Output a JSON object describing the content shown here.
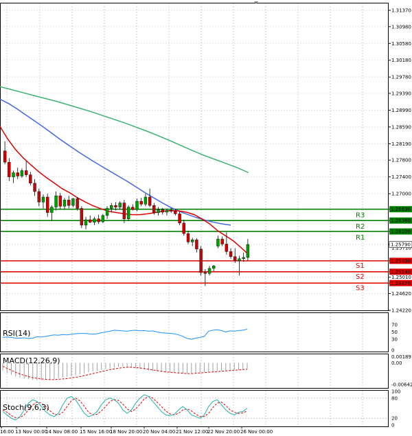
{
  "chart_data": {
    "type": "candlestick",
    "instrument": "",
    "main": {
      "ylim": [
        1.2422,
        1.3155
      ],
      "y_ticks": [
        "1.31370",
        "1.30980",
        "1.30580",
        "1.30180",
        "1.29780",
        "1.29390",
        "1.28990",
        "1.28590",
        "1.28190",
        "1.27800",
        "1.27400",
        "1.27000",
        "1.26630",
        "1.26360",
        "1.26100",
        "1.25790",
        "1.25400",
        "1.25140",
        "1.25010",
        "1.24870",
        "1.24620",
        "1.24220"
      ],
      "grid": true,
      "levels": [
        {
          "label": "R3",
          "value": 1.2663,
          "price": "1.26630",
          "color": "#008000"
        },
        {
          "label": "R2",
          "value": 1.2636,
          "price": "1.26360",
          "color": "#008000"
        },
        {
          "label": "R1",
          "value": 1.261,
          "price": "1.26100",
          "color": "#008000"
        },
        {
          "label": "S1",
          "value": 1.254,
          "price": "1.25400",
          "color": "#e00000"
        },
        {
          "label": "S2",
          "value": 1.2514,
          "price": "1.25140",
          "color": "#e00000"
        },
        {
          "label": "S3",
          "value": 1.2487,
          "price": "1.24870",
          "color": "#e00000"
        }
      ],
      "extra_tick": {
        "price": "1.25710",
        "value": 1.2571
      },
      "current": {
        "price": "1.25790",
        "value": 1.2579
      },
      "candles": [
        [
          1.2802,
          1.2825,
          1.277,
          1.2775
        ],
        [
          1.2775,
          1.2785,
          1.273,
          1.274
        ],
        [
          1.274,
          1.2755,
          1.2725,
          1.275
        ],
        [
          1.275,
          1.2762,
          1.2735,
          1.2742
        ],
        [
          1.2742,
          1.276,
          1.2738,
          1.2755
        ],
        [
          1.2755,
          1.2778,
          1.274,
          1.2745
        ],
        [
          1.2745,
          1.2752,
          1.272,
          1.2725
        ],
        [
          1.2725,
          1.2735,
          1.2695,
          1.2705
        ],
        [
          1.2705,
          1.2712,
          1.267,
          1.268
        ],
        [
          1.268,
          1.2698,
          1.2665,
          1.2692
        ],
        [
          1.2692,
          1.27,
          1.2645,
          1.2655
        ],
        [
          1.2655,
          1.2672,
          1.2635,
          1.2668
        ],
        [
          1.2668,
          1.2705,
          1.266,
          1.2695
        ],
        [
          1.2695,
          1.2702,
          1.2662,
          1.267
        ],
        [
          1.267,
          1.269,
          1.2662,
          1.2685
        ],
        [
          1.2685,
          1.2695,
          1.2665,
          1.2672
        ],
        [
          1.2672,
          1.269,
          1.2668,
          1.2688
        ],
        [
          1.2688,
          1.2692,
          1.266,
          1.2665
        ],
        [
          1.2665,
          1.267,
          1.2618,
          1.2625
        ],
        [
          1.2625,
          1.2645,
          1.2615,
          1.2638
        ],
        [
          1.2638,
          1.2648,
          1.263,
          1.2632
        ],
        [
          1.2632,
          1.2645,
          1.2625,
          1.264
        ],
        [
          1.264,
          1.265,
          1.2628,
          1.2633
        ],
        [
          1.2633,
          1.2652,
          1.263,
          1.2648
        ],
        [
          1.2648,
          1.267,
          1.264,
          1.2665
        ],
        [
          1.2665,
          1.2678,
          1.2655,
          1.2672
        ],
        [
          1.2672,
          1.268,
          1.266,
          1.2668
        ],
        [
          1.2668,
          1.2682,
          1.2662,
          1.2678
        ],
        [
          1.2678,
          1.2685,
          1.263,
          1.264
        ],
        [
          1.264,
          1.2672,
          1.2635,
          1.2668
        ],
        [
          1.2668,
          1.2675,
          1.266,
          1.2662
        ],
        [
          1.2662,
          1.2688,
          1.2658,
          1.2682
        ],
        [
          1.2682,
          1.269,
          1.267,
          1.2675
        ],
        [
          1.2675,
          1.27,
          1.267,
          1.2692
        ],
        [
          1.2692,
          1.2712,
          1.2668,
          1.2672
        ],
        [
          1.2672,
          1.2678,
          1.265,
          1.2655
        ],
        [
          1.2655,
          1.2668,
          1.2648,
          1.2662
        ],
        [
          1.2662,
          1.2666,
          1.265,
          1.2656
        ],
        [
          1.2656,
          1.2664,
          1.2648,
          1.266
        ],
        [
          1.266,
          1.2666,
          1.2654,
          1.2658
        ],
        [
          1.2658,
          1.2664,
          1.2648,
          1.2652
        ],
        [
          1.2652,
          1.2658,
          1.2625,
          1.263
        ],
        [
          1.263,
          1.2638,
          1.26,
          1.2605
        ],
        [
          1.2605,
          1.2612,
          1.258,
          1.2585
        ],
        [
          1.2585,
          1.2595,
          1.2575,
          1.259
        ],
        [
          1.259,
          1.2594,
          1.256,
          1.2568
        ],
        [
          1.2568,
          1.2575,
          1.2505,
          1.2512
        ],
        [
          1.2512,
          1.252,
          1.248,
          1.251
        ],
        [
          1.251,
          1.2528,
          1.2505,
          1.2522
        ],
        [
          1.2522,
          1.253,
          1.2515,
          1.2528
        ],
        [
          1.2575,
          1.26,
          1.257,
          1.2592
        ],
        [
          1.2592,
          1.2598,
          1.2575,
          1.258
        ],
        [
          1.258,
          1.2608,
          1.2555,
          1.2562
        ],
        [
          1.2562,
          1.257,
          1.2545,
          1.255
        ],
        [
          1.255,
          1.257,
          1.2535,
          1.254
        ],
        [
          1.254,
          1.2552,
          1.2505,
          1.2545
        ],
        [
          1.2545,
          1.256,
          1.2538,
          1.2548
        ],
        [
          1.2548,
          1.2592,
          1.254,
          1.2579
        ]
      ],
      "ma_fast": [
        1.286,
        1.283,
        1.2805,
        1.2785,
        1.2768,
        1.2752,
        1.2738,
        1.2725,
        1.2712,
        1.2702,
        1.269,
        1.268,
        1.2671,
        1.2664,
        1.2658,
        1.2655,
        1.2652,
        1.265,
        1.265,
        1.2652,
        1.2655,
        1.2658,
        1.266,
        1.2659,
        1.2656,
        1.265,
        1.264,
        1.2628,
        1.2612,
        1.26,
        1.2588,
        1.2572,
        1.2555
      ],
      "ma_mid": [
        1.2925,
        1.2915,
        1.2902,
        1.2888,
        1.2874,
        1.286,
        1.2845,
        1.283,
        1.2816,
        1.2802,
        1.2789,
        1.2776,
        1.2764,
        1.2752,
        1.274,
        1.2728,
        1.2715,
        1.2702,
        1.269,
        1.2678,
        1.2667,
        1.2658,
        1.265,
        1.2643,
        1.2637,
        1.2632,
        1.2628,
        1.2625
      ],
      "ma_slow": [
        1.2955,
        1.2948,
        1.2941,
        1.2934,
        1.2927,
        1.292,
        1.2912,
        1.2904,
        1.2896,
        1.2887,
        1.2878,
        1.2869,
        1.2859,
        1.2849,
        1.2838,
        1.2827,
        1.2815,
        1.2803,
        1.2792,
        1.2782,
        1.2772,
        1.2762,
        1.275
      ]
    },
    "rsi": {
      "title": "RSI(14)",
      "ylim": [
        0,
        100
      ],
      "ticks": [
        "70",
        "50",
        "30",
        "0"
      ],
      "values": [
        35,
        36,
        35,
        33,
        33,
        34,
        32,
        33,
        37,
        36,
        38,
        40,
        42,
        41,
        43,
        42,
        44,
        45,
        46,
        46,
        45,
        44,
        45,
        48,
        50,
        52,
        55,
        54,
        53,
        52,
        54,
        55,
        53,
        54,
        52,
        53,
        50,
        48,
        47,
        46,
        45,
        42,
        38,
        32,
        30,
        33,
        35,
        38,
        52,
        55,
        56,
        54,
        50,
        53,
        52,
        54,
        55,
        58
      ]
    },
    "macd": {
      "title": "MACD(12,26,9)",
      "ylim": [
        -0.0075,
        0.0028
      ],
      "ticks": [
        "0.001891",
        "0.00",
        "-0.006422"
      ],
      "histogram": [
        -0.0022,
        -0.003,
        -0.0036,
        -0.0041,
        -0.0044,
        -0.0047,
        -0.0049,
        -0.0051,
        -0.0052,
        -0.0052,
        -0.0051,
        -0.005,
        -0.0048,
        -0.0046,
        -0.0044,
        -0.0042,
        -0.004,
        -0.0037,
        -0.0034,
        -0.0031,
        -0.0028,
        -0.0025,
        -0.0023,
        -0.002,
        -0.0018,
        -0.0016,
        -0.0014,
        -0.0012,
        -0.0011,
        -0.0012,
        -0.0014,
        -0.0016,
        -0.0018,
        -0.002,
        -0.0022,
        -0.0024,
        -0.0026,
        -0.0027,
        -0.0028,
        -0.0029,
        -0.003,
        -0.0031,
        -0.0032,
        -0.0032,
        -0.0031,
        -0.003,
        -0.0029,
        -0.0028,
        -0.0027,
        -0.0026,
        -0.0025,
        -0.0024,
        -0.0023,
        -0.0022,
        -0.0021,
        -0.002,
        -0.0019,
        -0.0018
      ],
      "signal": [
        -0.001,
        -0.0016,
        -0.0022,
        -0.0028,
        -0.0033,
        -0.0037,
        -0.0041,
        -0.0044,
        -0.0046,
        -0.0048,
        -0.0049,
        -0.005,
        -0.005,
        -0.0049,
        -0.0048,
        -0.0047,
        -0.0045,
        -0.0043,
        -0.0041,
        -0.0038,
        -0.0035,
        -0.0032,
        -0.0029,
        -0.0026,
        -0.0023,
        -0.002,
        -0.0018,
        -0.0016,
        -0.0014,
        -0.0013,
        -0.0013,
        -0.0014,
        -0.0015,
        -0.0017,
        -0.0019,
        -0.0021,
        -0.0023,
        -0.0025,
        -0.0027,
        -0.0028,
        -0.0029,
        -0.003,
        -0.0031,
        -0.0032,
        -0.0032,
        -0.0031,
        -0.003,
        -0.0029,
        -0.0028,
        -0.0027,
        -0.0026,
        -0.0025,
        -0.0024,
        -0.0023,
        -0.0022,
        -0.0021,
        -0.002,
        -0.0019
      ]
    },
    "stoch": {
      "title": "Stoch(9,6,3)",
      "ylim": [
        0,
        100
      ],
      "ticks": [
        "100",
        "80",
        "20",
        "0"
      ],
      "k": [
        40,
        30,
        20,
        15,
        25,
        45,
        65,
        75,
        70,
        55,
        40,
        30,
        25,
        35,
        60,
        80,
        85,
        75,
        55,
        35,
        25,
        30,
        40,
        60,
        75,
        80,
        75,
        65,
        45,
        35,
        45,
        65,
        80,
        90,
        85,
        70,
        55,
        40,
        30,
        28,
        32,
        45,
        55,
        45,
        30,
        25,
        20,
        30,
        55,
        70,
        75,
        60,
        45,
        35,
        30,
        38,
        40,
        50
      ],
      "d": [
        45,
        38,
        28,
        22,
        22,
        30,
        45,
        60,
        68,
        65,
        55,
        42,
        32,
        30,
        38,
        55,
        72,
        80,
        72,
        55,
        38,
        30,
        32,
        42,
        55,
        70,
        76,
        73,
        62,
        48,
        40,
        48,
        62,
        78,
        85,
        80,
        68,
        55,
        42,
        33,
        30,
        35,
        45,
        48,
        42,
        32,
        25,
        25,
        35,
        52,
        65,
        68,
        58,
        45,
        38,
        34,
        36,
        42
      ]
    },
    "x_labels": [
      "16:00",
      "13 Nov 00:00",
      "14 Nov 08:00",
      "15 Nov 16:00",
      "18 Nov 20:00",
      "20 Nov 04:00",
      "21 Nov 12:00",
      "22 Nov 20:00",
      "26 Nov 00:00"
    ]
  }
}
